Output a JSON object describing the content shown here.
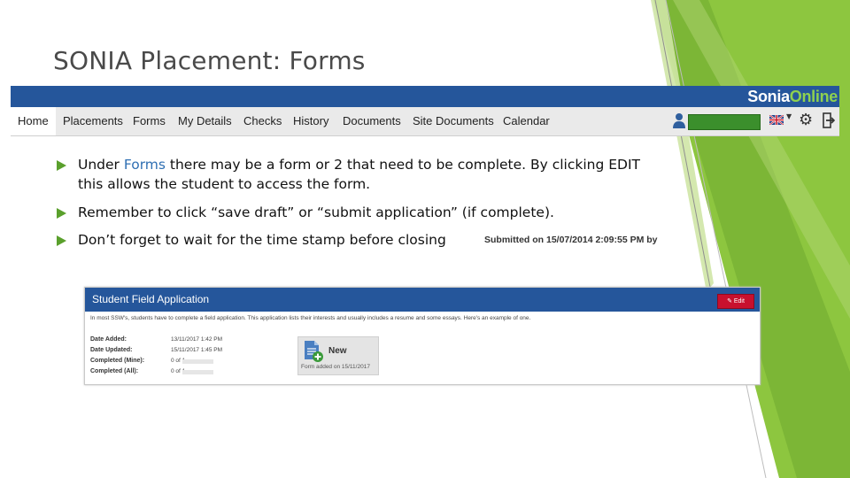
{
  "slide": {
    "title": "SONIA Placement: Forms"
  },
  "colors": {
    "accent_green": "#8dc63f",
    "dark_green": "#5aa02c",
    "sonia_blue": "#25569b",
    "edit_red": "#c8102e"
  },
  "app": {
    "logo_part1": "Sonia",
    "logo_part2": "Online",
    "nav": [
      "Home",
      "Placements",
      "Forms",
      "My Details",
      "Checks",
      "History",
      "Documents",
      "Site Documents",
      "Calendar"
    ],
    "icons": [
      "user-icon",
      "uk-flag-icon",
      "settings-gear-icon",
      "logout-icon"
    ]
  },
  "bullets": {
    "b1_pre": "Under ",
    "b1_hl": "Forms",
    "b1_post": " there may be a form or 2 that need to be complete. By clicking EDIT this allows the student to access the form.",
    "b2": "Remember to click “save draft” or “submit application” (if complete).",
    "b3": "Don’t forget to wait for the time stamp before closing",
    "stamp": "Submitted on 15/07/2014 2:09:55 PM by"
  },
  "panel": {
    "title": "Student Field Application",
    "edit_label": "✎ Edit",
    "description": "In most SSW's, students have to complete a field application. This application lists their interests and usually includes a resume and some essays. Here's an example of one.",
    "fields": [
      {
        "label": "Date Added:",
        "value": "13/11/2017 1:42 PM"
      },
      {
        "label": "Date Updated:",
        "value": "15/11/2017 1:45 PM"
      },
      {
        "label": "Completed (Mine):",
        "value": "0 of 1"
      },
      {
        "label": "Completed (All):",
        "value": "0 of 1"
      }
    ],
    "tile_title": "New",
    "tile_added": "Form added on 15/11/2017"
  }
}
